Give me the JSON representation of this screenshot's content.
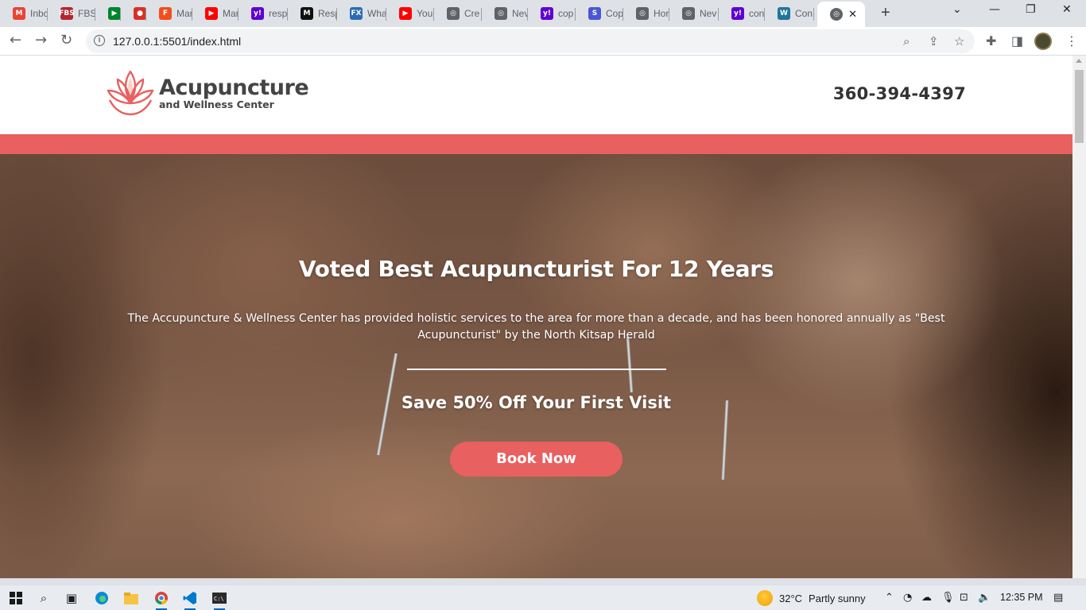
{
  "browser": {
    "tabs": [
      {
        "title": "Inbc",
        "icon": "gmail-icon",
        "color": "#ea4335",
        "glyph": "M"
      },
      {
        "title": "FBS",
        "icon": "fbs-icon",
        "color": "#b3262d",
        "glyph": "FBS"
      },
      {
        "title": "",
        "icon": "google-meet-icon",
        "color": "#00832d",
        "glyph": "▶"
      },
      {
        "title": "",
        "icon": "record-icon",
        "color": "#d93025",
        "glyph": "●"
      },
      {
        "title": "Mar",
        "icon": "figma-icon",
        "color": "#f24e1e",
        "glyph": "F"
      },
      {
        "title": "Mar",
        "icon": "youtube-icon",
        "color": "#ff0000",
        "glyph": "▶"
      },
      {
        "title": "resp",
        "icon": "yahoo-icon",
        "color": "#6001d2",
        "glyph": "y!"
      },
      {
        "title": "Resp",
        "icon": "medium-icon",
        "color": "#111111",
        "glyph": "M"
      },
      {
        "title": "Wha",
        "icon": "fx-icon",
        "color": "#2b6cb0",
        "glyph": "FX"
      },
      {
        "title": "You",
        "icon": "youtube-icon",
        "color": "#ff0000",
        "glyph": "▶"
      },
      {
        "title": "Cre",
        "icon": "globe-icon",
        "color": "#5f6368",
        "glyph": "◎"
      },
      {
        "title": "Nev",
        "icon": "globe-icon",
        "color": "#5f6368",
        "glyph": "◎"
      },
      {
        "title": "cop",
        "icon": "yahoo-icon",
        "color": "#6001d2",
        "glyph": "y!"
      },
      {
        "title": "Cop",
        "icon": "s-icon",
        "color": "#4a57d4",
        "glyph": "S"
      },
      {
        "title": "Hor",
        "icon": "globe-icon",
        "color": "#5f6368",
        "glyph": "◎"
      },
      {
        "title": "Nev",
        "icon": "globe-icon",
        "color": "#5f6368",
        "glyph": "◎"
      },
      {
        "title": "con",
        "icon": "yahoo-icon",
        "color": "#6001d2",
        "glyph": "y!"
      },
      {
        "title": "Con",
        "icon": "wordpress-icon",
        "color": "#21759b",
        "glyph": "W"
      }
    ],
    "active_tab_icon": "globe-icon",
    "url": "127.0.0.1:5501/index.html"
  },
  "site": {
    "logo": {
      "title": "Acupuncture",
      "subtitle": "and Wellness Center"
    },
    "phone": "360-394-4397",
    "accent_color": "#e8605f",
    "hero": {
      "title": "Voted Best Acupuncturist For 12 Years",
      "text": "The Accupuncture & Wellness Center has provided holistic services to the area for more than a decade, and has been honored annually as \"Best Acupuncturist\" by the North Kitsap Herald",
      "offer": "Save 50% Off Your First Visit",
      "cta": "Book Now"
    }
  },
  "taskbar": {
    "weather_temp": "32°C",
    "weather_desc": "Partly sunny",
    "time": "12:35 PM"
  }
}
